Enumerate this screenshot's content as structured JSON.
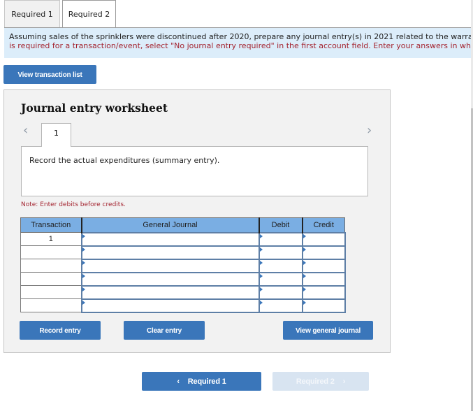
{
  "tabs": [
    {
      "label": "Required 1",
      "active": false
    },
    {
      "label": "Required 2",
      "active": true
    }
  ],
  "instructions": {
    "line1": "Assuming sales of the sprinklers were discontinued after 2020, prepare any journal entry(s) in 2021 related to the warra",
    "line2": "is required for a transaction/event, select \"No journal entry required\" in the first account field. Enter your answers in who"
  },
  "buttons": {
    "view_transaction_list": "View transaction list",
    "record_entry": "Record entry",
    "clear_entry": "Clear entry",
    "view_general_journal": "View general journal",
    "prev_required": "Required 1",
    "next_required": "Required 2"
  },
  "worksheet": {
    "title": "Journal entry worksheet",
    "entry_tab": "1",
    "prev_icon": "‹",
    "next_icon": "›",
    "description": "Record the actual expenditures (summary entry).",
    "note": "Note: Enter debits before credits."
  },
  "table": {
    "headers": [
      "Transaction",
      "General Journal",
      "Debit",
      "Credit"
    ],
    "rows": [
      {
        "transaction": "1",
        "account": "",
        "debit": "",
        "credit": ""
      },
      {
        "transaction": "",
        "account": "",
        "debit": "",
        "credit": ""
      },
      {
        "transaction": "",
        "account": "",
        "debit": "",
        "credit": ""
      },
      {
        "transaction": "",
        "account": "",
        "debit": "",
        "credit": ""
      },
      {
        "transaction": "",
        "account": "",
        "debit": "",
        "credit": ""
      },
      {
        "transaction": "",
        "account": "",
        "debit": "",
        "credit": ""
      }
    ]
  },
  "icons": {
    "chevron_left": "‹",
    "chevron_right": "›"
  },
  "colors": {
    "primary_button": "#3a76ba",
    "disabled_button": "#d8e4f1",
    "instructions_bg": "#dcedfa",
    "instructions_red": "#a3232f",
    "table_header": "#7aaee3"
  }
}
